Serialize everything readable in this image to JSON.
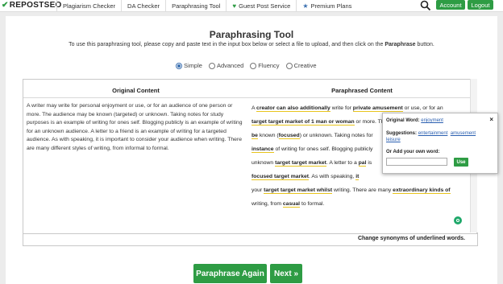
{
  "brand": {
    "logo_check": "✔",
    "logo_text": "REPOSTSEO"
  },
  "nav": {
    "items": [
      {
        "label": "Plagiarism Checker"
      },
      {
        "label": "DA Checker"
      },
      {
        "label": "Paraphrasing Tool"
      },
      {
        "label": "Guest Post Service",
        "icon": "heart-icon"
      },
      {
        "label": "Premium Plans",
        "icon": "star-icon"
      }
    ],
    "heart_glyph": "♥",
    "star_glyph": "★",
    "account": "Account",
    "logout": "Logout"
  },
  "page": {
    "title": "Paraphrasing Tool",
    "subtitle_before": "To use this paraphrasing tool, please copy and paste text in the input box below or select a file to upload, and then click on the ",
    "subtitle_strong": "Paraphrase",
    "subtitle_after": " button."
  },
  "modes": {
    "selected": "Simple",
    "options": [
      "Simple",
      "Advanced",
      "Fluency",
      "Creative"
    ]
  },
  "original": {
    "header": "Original Content",
    "text": "A writer may write for personal enjoyment or use, or for an audience of one person or more. The audience may be known (targeted) or unknown. Taking notes for study purposes is an example of writing for ones self. Blogging publicly is an example of writing for an unknown audience. A letter to a friend is an example of writing for a targeted audience. As with speaking, it is important to consider your audience when writing. There are many different styles of writing, from informal to formal."
  },
  "paraphrased": {
    "header": "Paraphrased Content",
    "lines": [
      [
        {
          "t": "A "
        },
        {
          "t": "creator can also additionally",
          "u": true
        },
        {
          "t": " write for "
        },
        {
          "t": "private amusement",
          "u": true
        },
        {
          "t": " or use, or for an"
        }
      ],
      [
        {
          "t": "target target market of 1 man or woman",
          "u": true
        },
        {
          "t": " or more. The target"
        }
      ],
      [
        {
          "t": "be",
          "u": true
        },
        {
          "t": " known ("
        },
        {
          "t": "focused",
          "u": true
        },
        {
          "t": ") or unknown. Taking notes for"
        }
      ],
      [
        {
          "t": "instance",
          "u": true
        },
        {
          "t": " of writing for ones self. Blogging publicly"
        }
      ],
      [
        {
          "t": "unknown "
        },
        {
          "t": "target target market",
          "u": true
        },
        {
          "t": ". A letter to a "
        },
        {
          "t": "pal",
          "u": true
        },
        {
          "t": " is"
        }
      ],
      [
        {
          "t": "focused target market",
          "u": true
        },
        {
          "t": ". As with speaking, "
        },
        {
          "t": "it",
          "u": true
        }
      ],
      [
        {
          "t": "your "
        },
        {
          "t": "target target market whilst",
          "u": true
        },
        {
          "t": " writing. There are many "
        },
        {
          "t": "extraordinary kinds of",
          "u": true
        }
      ],
      [
        {
          "t": "writing, from "
        },
        {
          "t": "casual",
          "u": true
        },
        {
          "t": " to formal."
        }
      ]
    ]
  },
  "popup": {
    "original_label": "Original Word:",
    "original_word": "enjoyment",
    "suggestions_label": "Suggestions:",
    "suggestions": [
      "entertainment",
      "amusement",
      "leisure"
    ],
    "own_label": "Or Add your own word:",
    "input_value": "",
    "use_button": "Use",
    "close": "×"
  },
  "hint": "Change synonyms of underlined words.",
  "actions": {
    "again": "Paraphrase Again",
    "next": "Next »"
  }
}
